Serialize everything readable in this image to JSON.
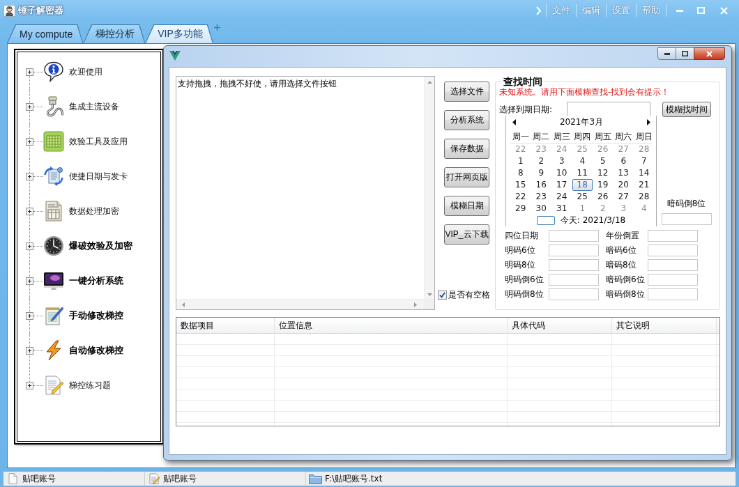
{
  "window": {
    "title": "锤子解密器",
    "menu": [
      "文件",
      "编辑",
      "设置",
      "帮助"
    ]
  },
  "tabs": [
    {
      "label": "My compute",
      "selected": false
    },
    {
      "label": "梯控分析",
      "selected": false
    },
    {
      "label": "VIP多功能",
      "selected": true
    }
  ],
  "tree": {
    "items": [
      {
        "label": "欢迎使用",
        "bold": false,
        "expanded": false
      },
      {
        "label": "集成主流设备",
        "bold": false,
        "expanded": false
      },
      {
        "label": "效验工具及应用",
        "bold": false,
        "expanded": false
      },
      {
        "label": "便捷日期与发卡",
        "bold": false,
        "expanded": false
      },
      {
        "label": "数据处理加密",
        "bold": false,
        "expanded": false
      },
      {
        "label": "爆破效验及加密",
        "bold": true,
        "expanded": false
      },
      {
        "label": "一键分析系统",
        "bold": true,
        "expanded": false
      },
      {
        "label": "手动修改梯控",
        "bold": true,
        "expanded": false
      },
      {
        "label": "自动修改梯控",
        "bold": true,
        "expanded": false
      },
      {
        "label": "梯控练习题",
        "bold": false,
        "expanded": false
      }
    ]
  },
  "dialog": {
    "text_area": {
      "value": "支持拖拽，拖拽不好使，请用选择文件按钮"
    },
    "buttons": [
      "选择文件",
      "分析系统",
      "保存数据",
      "打开网页版",
      "模糊日期",
      "VIP_云下载"
    ],
    "space_checkbox": {
      "label": "是否有空格",
      "checked": true
    },
    "search_panel": {
      "title": "查找时间",
      "notice": "未知系统。请用下面模糊查找-找到会有提示！",
      "date_label": "选择到期日期:",
      "search_button": "模糊找时间",
      "calendar": {
        "month": "2021年3月",
        "weekdays": [
          "周一",
          "周二",
          "周三",
          "周四",
          "周五",
          "周六",
          "周日"
        ],
        "weeks": [
          [
            {
              "day": "22",
              "muted": true,
              "selected": false
            },
            {
              "day": "23",
              "muted": true,
              "selected": false
            },
            {
              "day": "24",
              "muted": true,
              "selected": false
            },
            {
              "day": "25",
              "muted": true,
              "selected": false
            },
            {
              "day": "26",
              "muted": true,
              "selected": false
            },
            {
              "day": "27",
              "muted": true,
              "selected": false
            },
            {
              "day": "28",
              "muted": true,
              "selected": false
            }
          ],
          [
            {
              "day": "1",
              "muted": false,
              "selected": false
            },
            {
              "day": "2",
              "muted": false,
              "selected": false
            },
            {
              "day": "3",
              "muted": false,
              "selected": false
            },
            {
              "day": "4",
              "muted": false,
              "selected": false
            },
            {
              "day": "5",
              "muted": false,
              "selected": false
            },
            {
              "day": "6",
              "muted": false,
              "selected": false
            },
            {
              "day": "7",
              "muted": false,
              "selected": false
            }
          ],
          [
            {
              "day": "8",
              "muted": false,
              "selected": false
            },
            {
              "day": "9",
              "muted": false,
              "selected": false
            },
            {
              "day": "10",
              "muted": false,
              "selected": false
            },
            {
              "day": "11",
              "muted": false,
              "selected": false
            },
            {
              "day": "12",
              "muted": false,
              "selected": false
            },
            {
              "day": "13",
              "muted": false,
              "selected": false
            },
            {
              "day": "14",
              "muted": false,
              "selected": false
            }
          ],
          [
            {
              "day": "15",
              "muted": false,
              "selected": false
            },
            {
              "day": "16",
              "muted": false,
              "selected": false
            },
            {
              "day": "17",
              "muted": false,
              "selected": false
            },
            {
              "day": "18",
              "muted": false,
              "selected": true
            },
            {
              "day": "19",
              "muted": false,
              "selected": false
            },
            {
              "day": "20",
              "muted": false,
              "selected": false
            },
            {
              "day": "21",
              "muted": false,
              "selected": false
            }
          ],
          [
            {
              "day": "22",
              "muted": false,
              "selected": false
            },
            {
              "day": "23",
              "muted": false,
              "selected": false
            },
            {
              "day": "24",
              "muted": false,
              "selected": false
            },
            {
              "day": "25",
              "muted": false,
              "selected": false
            },
            {
              "day": "26",
              "muted": false,
              "selected": false
            },
            {
              "day": "27",
              "muted": false,
              "selected": false
            },
            {
              "day": "28",
              "muted": false,
              "selected": false
            }
          ],
          [
            {
              "day": "29",
              "muted": false,
              "selected": false
            },
            {
              "day": "30",
              "muted": false,
              "selected": false
            },
            {
              "day": "31",
              "muted": false,
              "selected": false
            },
            {
              "day": "1",
              "muted": true,
              "selected": false
            },
            {
              "day": "2",
              "muted": true,
              "selected": false
            },
            {
              "day": "3",
              "muted": true,
              "selected": false
            },
            {
              "day": "4",
              "muted": true,
              "selected": false
            }
          ]
        ],
        "today": "今天: 2021/3/18"
      },
      "side_field": {
        "label": "暗码倒8位"
      },
      "fields": [
        {
          "label": "四位日期"
        },
        {
          "label": "年份倒置"
        },
        {
          "label": "明码6位"
        },
        {
          "label": "暗码6位"
        },
        {
          "label": "明码8位"
        },
        {
          "label": "暗码8位"
        },
        {
          "label": "明码倒6位"
        },
        {
          "label": "暗码倒6位"
        },
        {
          "label": "明码倒8位"
        },
        {
          "label": "暗码倒8位"
        }
      ]
    },
    "table": {
      "columns": [
        "数据项目",
        "位置信息",
        "具体代码",
        "其它说明"
      ]
    }
  },
  "status_bar": [
    {
      "text": "贴吧账号"
    },
    {
      "text": "贴吧账号"
    },
    {
      "text": "F:\\贴吧账号.txt"
    }
  ]
}
